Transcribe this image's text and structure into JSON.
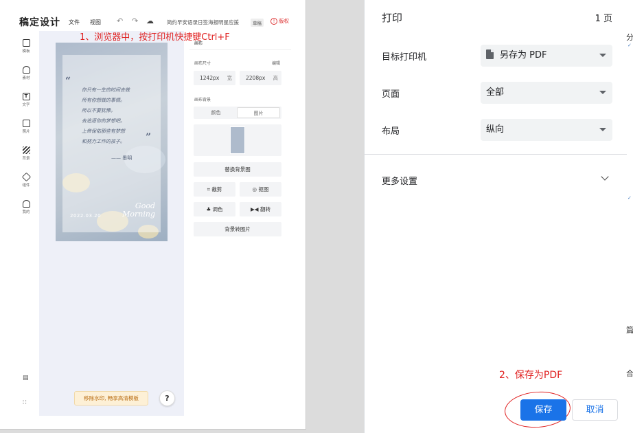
{
  "editor": {
    "brand": "稿定设计",
    "menu": [
      "文件",
      "视图"
    ],
    "doc_title": "简约早安语录日签海报明星应援",
    "draft_badge": "草稿",
    "copyright": "版权",
    "sidebar": [
      {
        "label": "模板",
        "icon": "template-icon"
      },
      {
        "label": "素材",
        "icon": "shapes-icon"
      },
      {
        "label": "文字",
        "icon": "text-icon"
      },
      {
        "label": "照片",
        "icon": "image-icon"
      },
      {
        "label": "背景",
        "icon": "background-icon"
      },
      {
        "label": "组件",
        "icon": "cube-icon"
      },
      {
        "label": "我的",
        "icon": "cloud-upload-icon"
      }
    ],
    "poster": {
      "lines": [
        "你只有一生的时间去做",
        "所有你想做的事情。",
        "所以不要犹豫，",
        "去追逐你的梦想吧。",
        "上帝保佑那些有梦想",
        "和努力工作的孩子。"
      ],
      "author": "—— 墨明",
      "greeting_1": "Good",
      "greeting_2": "Morning",
      "date": "2022.03.20"
    },
    "panel": {
      "section_canvas": "画布",
      "size_label": "画布尺寸",
      "edit_label": "编辑",
      "width_value": "1242px",
      "width_unit": "宽",
      "height_value": "2208px",
      "height_unit": "高",
      "bg_label": "画布背景",
      "tab_color": "颜色",
      "tab_image": "图片",
      "replace_bg": "替换背景图",
      "crop": "裁剪",
      "cutout": "抠图",
      "adjust": "调色",
      "flip": "翻转",
      "bg_to_image": "背景转图片"
    },
    "watermark_button": "移除水印, 畅享高清模板",
    "help": "?"
  },
  "annotations": {
    "step1": "1、浏览器中，按打印机快捷键Ctrl+F",
    "step2": "2、保存为PDF"
  },
  "print_dialog": {
    "title": "打印",
    "page_count": "1 页",
    "destination_label": "目标打印机",
    "destination_value": "另存为 PDF",
    "pages_label": "页面",
    "pages_value": "全部",
    "layout_label": "布局",
    "layout_value": "纵向",
    "more_settings": "更多设置",
    "save": "保存",
    "cancel": "取消"
  },
  "colors": {
    "accent": "#1a73e8",
    "annotation": "#e02020"
  }
}
